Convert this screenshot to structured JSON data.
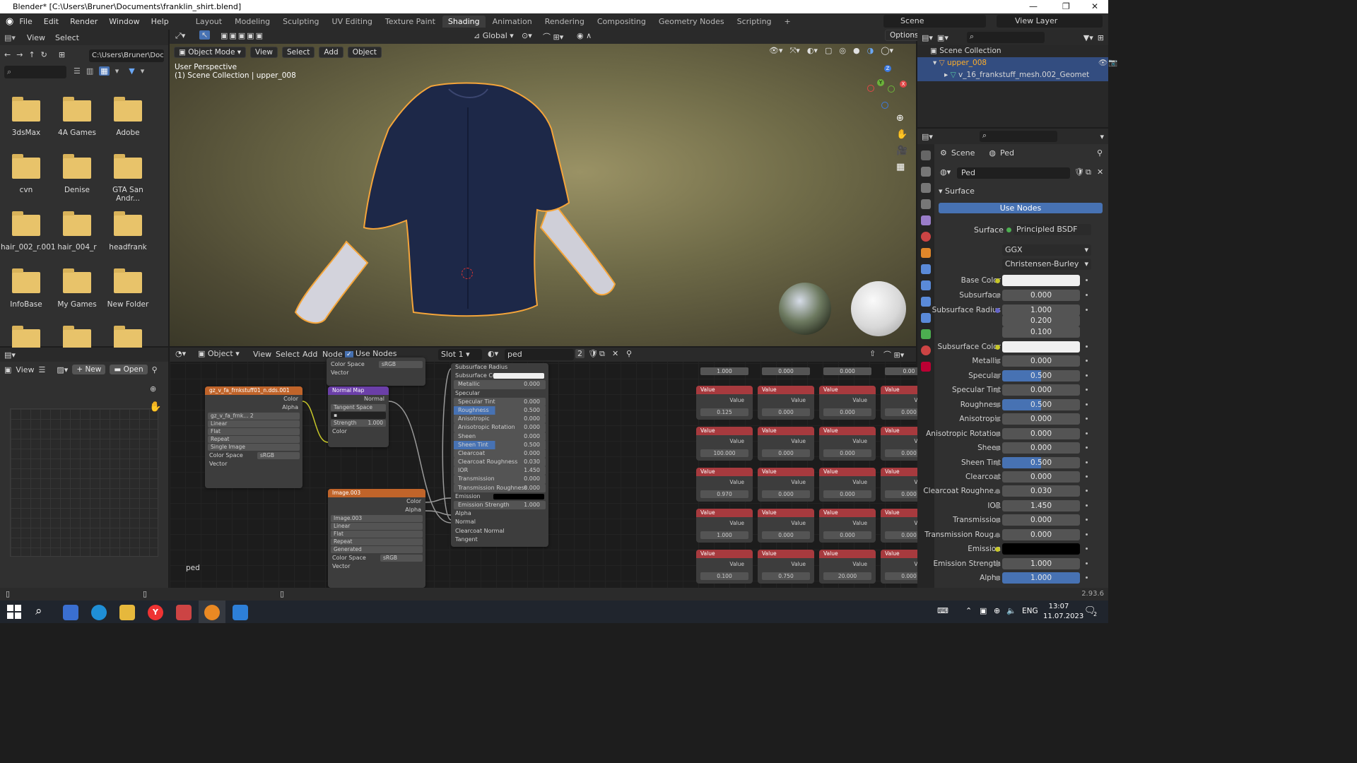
{
  "window": {
    "title": "Blender* [C:\\Users\\Bruner\\Documents\\franklin_shirt.blend]"
  },
  "menu": [
    "File",
    "Edit",
    "Render",
    "Window",
    "Help"
  ],
  "workspaces": [
    "Layout",
    "Modeling",
    "Sculpting",
    "UV Editing",
    "Texture Paint",
    "Shading",
    "Animation",
    "Rendering",
    "Compositing",
    "Geometry Nodes",
    "Scripting"
  ],
  "active_workspace": "Shading",
  "scene": {
    "name": "Scene",
    "view_layer": "View Layer"
  },
  "file_browser": {
    "menu": [
      "View",
      "Select"
    ],
    "path": "C:\\Users\\Bruner\\Docu...",
    "folders": [
      "3dsMax",
      "4A Games",
      "Adobe",
      "cvn",
      "Denise",
      "GTA San Andr...",
      "hair_002_r.001",
      "hair_004_r",
      "headfrank",
      "InfoBase",
      "My Games",
      "New Folder"
    ]
  },
  "image_editor": {
    "view_label": "View",
    "new_label": "New",
    "open_label": "Open"
  },
  "viewport": {
    "mode": "Object Mode",
    "menu": [
      "View",
      "Select",
      "Add",
      "Object"
    ],
    "transform": "Global",
    "options": "Options",
    "info_line1": "User Perspective",
    "info_line2": "(1) Scene Collection | upper_008"
  },
  "node_editor": {
    "type": "Object",
    "menu": [
      "View",
      "Select",
      "Add",
      "Node"
    ],
    "use_nodes": "Use Nodes",
    "slot": "Slot 1",
    "material": "ped",
    "users": "2",
    "footer_label": "ped",
    "tex_node": {
      "title": "gz_v_fa_frnkstuff01_n.dds.001",
      "out_color": "Color",
      "out_alpha": "Alpha",
      "image": "gz_v_fa_frnk...",
      "users": "2",
      "interp": "Linear",
      "proj": "Flat",
      "ext": "Repeat",
      "source": "Single Image",
      "cs_label": "Color Space",
      "cs": "sRGB",
      "vector": "Vector"
    },
    "top_node": {
      "cs_label": "Color Space",
      "cs": "sRGB",
      "vector": "Vector"
    },
    "normal_map": {
      "title": "Normal Map",
      "out": "Normal",
      "space": "Tangent Space",
      "strength_label": "Strength",
      "strength": "1.000",
      "color": "Color"
    },
    "image003": {
      "title": "Image.003",
      "out_color": "Color",
      "out_alpha": "Alpha",
      "image": "Image.003",
      "interp": "Linear",
      "proj": "Flat",
      "ext": "Repeat",
      "source": "Generated",
      "cs_label": "Color Space",
      "cs": "sRGB",
      "vector": "Vector"
    },
    "bsdf_rows": [
      {
        "label": "Subsurface Radius",
        "value": ""
      },
      {
        "label": "Subsurface Col...",
        "value": ""
      },
      {
        "label": "Metallic",
        "value": "0.000"
      },
      {
        "label": "Specular",
        "value": ""
      },
      {
        "label": "Specular Tint",
        "value": "0.000"
      },
      {
        "label": "Roughness",
        "value": "0.500"
      },
      {
        "label": "Anisotropic",
        "value": "0.000"
      },
      {
        "label": "Anisotropic Rotation",
        "value": "0.000"
      },
      {
        "label": "Sheen",
        "value": "0.000"
      },
      {
        "label": "Sheen Tint",
        "value": "0.500"
      },
      {
        "label": "Clearcoat",
        "value": "0.000"
      },
      {
        "label": "Clearcoat Roughness",
        "value": "0.030"
      },
      {
        "label": "IOR",
        "value": "1.450"
      },
      {
        "label": "Transmission",
        "value": "0.000"
      },
      {
        "label": "Transmission Roughness",
        "value": "0.000"
      },
      {
        "label": "Emission",
        "value": ""
      },
      {
        "label": "Emission Strength",
        "value": "1.000"
      },
      {
        "label": "Alpha",
        "value": ""
      },
      {
        "label": "Normal",
        "value": ""
      },
      {
        "label": "Clearcoat Normal",
        "value": ""
      },
      {
        "label": "Tangent",
        "value": ""
      }
    ],
    "top_values": [
      "1.000",
      "0.000",
      "0.000",
      "0.00"
    ],
    "value_label": "Value",
    "value_nodes": [
      [
        "0.125",
        "0.000",
        "0.000",
        "0.000"
      ],
      [
        "100.000",
        "0.000",
        "0.000",
        "0.000"
      ],
      [
        "0.970",
        "0.000",
        "0.000",
        "0.000"
      ],
      [
        "1.000",
        "0.000",
        "0.000",
        "0.000"
      ],
      [
        "0.100",
        "0.750",
        "20.000",
        "0.000"
      ]
    ]
  },
  "outliner": {
    "collection": "Scene Collection",
    "object": "upper_008",
    "mesh": "v_16_frankstuff_mesh.002_Geomet"
  },
  "properties": {
    "breadcrumb_scene": "Scene",
    "breadcrumb_world": "Ped",
    "world_name": "Ped",
    "section": "Surface",
    "use_nodes": "Use Nodes",
    "surface_label": "Surface",
    "surface_value": "Principled BSDF",
    "distribution": "GGX",
    "sss_method": "Christensen-Burley",
    "rows": [
      {
        "label": "Base Color",
        "value": "",
        "socket": "yellow",
        "kind": "color-white"
      },
      {
        "label": "Subsurface",
        "value": "0.000",
        "socket": "grey",
        "kind": "num"
      },
      {
        "label": "Subsurface Radius",
        "value": "1.000",
        "socket": "purple",
        "kind": "num"
      },
      {
        "label": "",
        "value": "0.200",
        "socket": "",
        "kind": "num"
      },
      {
        "label": "",
        "value": "0.100",
        "socket": "",
        "kind": "num"
      },
      {
        "label": "Subsurface Color",
        "value": "",
        "socket": "yellow",
        "kind": "color-white"
      },
      {
        "label": "Metallic",
        "value": "0.000",
        "socket": "grey",
        "kind": "num"
      },
      {
        "label": "Specular",
        "value": "0.500",
        "socket": "grey",
        "kind": "bar"
      },
      {
        "label": "Specular Tint",
        "value": "0.000",
        "socket": "grey",
        "kind": "num"
      },
      {
        "label": "Roughness",
        "value": "0.500",
        "socket": "grey",
        "kind": "bar"
      },
      {
        "label": "Anisotropic",
        "value": "0.000",
        "socket": "grey",
        "kind": "num"
      },
      {
        "label": "Anisotropic Rotation",
        "value": "0.000",
        "socket": "grey",
        "kind": "num"
      },
      {
        "label": "Sheen",
        "value": "0.000",
        "socket": "grey",
        "kind": "num"
      },
      {
        "label": "Sheen Tint",
        "value": "0.500",
        "socket": "grey",
        "kind": "bar"
      },
      {
        "label": "Clearcoat",
        "value": "0.000",
        "socket": "grey",
        "kind": "num"
      },
      {
        "label": "Clearcoat Roughne...",
        "value": "0.030",
        "socket": "grey",
        "kind": "num"
      },
      {
        "label": "IOR",
        "value": "1.450",
        "socket": "grey",
        "kind": "num"
      },
      {
        "label": "Transmission",
        "value": "0.000",
        "socket": "grey",
        "kind": "num"
      },
      {
        "label": "Transmission Roug...",
        "value": "0.000",
        "socket": "grey",
        "kind": "num"
      },
      {
        "label": "Emission",
        "value": "",
        "socket": "yellow",
        "kind": "color-black"
      },
      {
        "label": "Emission Strength",
        "value": "1.000",
        "socket": "grey",
        "kind": "num"
      },
      {
        "label": "Alpha",
        "value": "1.000",
        "socket": "grey",
        "kind": "full"
      }
    ]
  },
  "status": {
    "version": "2.93.6"
  },
  "taskbar": {
    "lang": "ENG",
    "time": "13:07",
    "date": "11.07.2023",
    "notif": "2"
  },
  "colors": {
    "accent": "#4772b3",
    "selection_outline": "#f5a53a",
    "value_node": "#a73a3e",
    "texture_node": "#c0642a",
    "vector_node": "#6b3fa8"
  }
}
